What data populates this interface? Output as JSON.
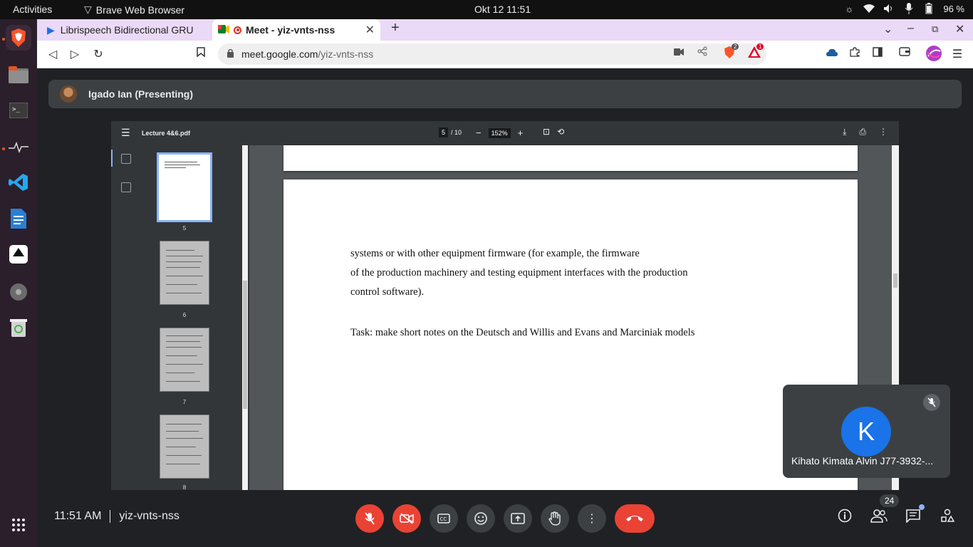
{
  "topbar": {
    "activities": "Activities",
    "app_name": "Brave Web Browser",
    "clock": "Okt 12  11:51",
    "battery": "96 %"
  },
  "dock": {
    "items": [
      "brave-browser",
      "files",
      "terminal",
      "system-monitor",
      "vscode",
      "libreoffice-writer",
      "inkscape",
      "disk",
      "trash"
    ]
  },
  "tabs": [
    {
      "title": "Librispeech Bidirectional GRU"
    },
    {
      "title": "Meet - yiz-vnts-nss"
    }
  ],
  "nav": {
    "url_host": "meet.google.com",
    "url_path": "/yiz-vnts-nss",
    "brave_shield_count": "2",
    "rewards_count": "1"
  },
  "presenter": {
    "label": "Igado Ian (Presenting)"
  },
  "pdf": {
    "filename": "Lecture 4&6.pdf",
    "current_page": "5",
    "total_pages": "/ 10",
    "zoom": "152%",
    "thumbnails": [
      {
        "num": "5"
      },
      {
        "num": "6"
      },
      {
        "num": "7"
      },
      {
        "num": "8"
      }
    ],
    "lines": [
      "systems or with other equipment firmware (for example, the firmware",
      "of the production machinery and testing equipment interfaces with the production",
      "control software).",
      "Task: make short notes on the Deutsch and Willis and Evans and Marciniak  models"
    ]
  },
  "self_tile": {
    "initial": "K",
    "name": "Kihato Kimata Alvin J77-3932-..."
  },
  "bottom": {
    "time": "11:51 AM",
    "meeting_code": "yiz-vnts-nss",
    "participant_count": "24"
  },
  "colors": {
    "danger": "#ea4335",
    "avatar": "#1a73e8",
    "meet_bg": "#202124"
  }
}
